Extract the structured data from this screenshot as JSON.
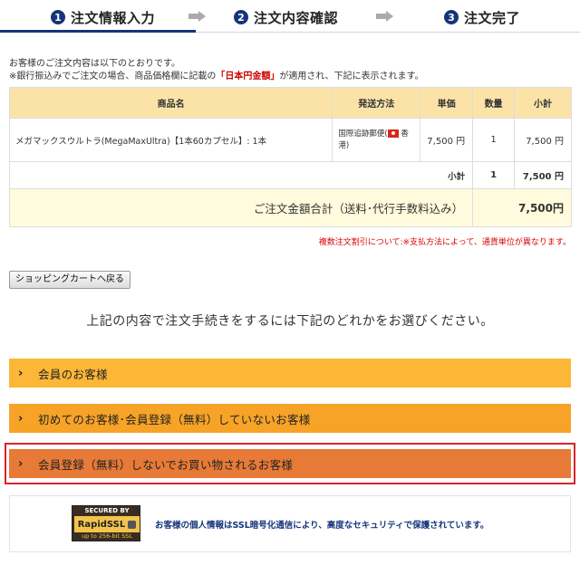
{
  "steps": {
    "step1": {
      "number": "1",
      "label": "注文情報入力"
    },
    "step2": {
      "number": "2",
      "label": "注文内容確認"
    },
    "step3": {
      "number": "3",
      "label": "注文完了"
    }
  },
  "intro": {
    "line1": "お客様のご注文内容は以下のとおりです。",
    "line2_prefix": "※銀行振込みでご注文の場合、商品価格欄に記載の",
    "line2_highlight": "「日本円金額」",
    "line2_suffix": "が適用され、下記に表示されます。"
  },
  "table": {
    "headers": {
      "name": "商品名",
      "shipping": "発送方法",
      "price": "単価",
      "qty": "数量",
      "subtotal": "小計"
    },
    "items": [
      {
        "name": "メガマックスウルトラ(MegaMaxUltra)【1本60カプセル】: 1本",
        "shipping_prefix": "国際追跡郵便(",
        "shipping_suffix": " 香港)",
        "flag_icon": "hong-kong-flag-icon",
        "price": "7,500 円",
        "qty": "1",
        "subtotal": "7,500 円"
      }
    ],
    "subtotal_row": {
      "label": "小計",
      "qty": "1",
      "value": "7,500 円"
    },
    "total_row": {
      "label": "ご注文金額合計（送料･代行手数料込み）",
      "value": "7,500円"
    }
  },
  "note": "複数注文割引について:※支払方法によって、通貨単位が異なります。",
  "back_button": "ショッピングカートへ戻る",
  "choose_text": "上記の内容で注文手続きをするには下記のどれかをお選びください。",
  "options": [
    {
      "label": "会員のお客様",
      "color": "#fcb737"
    },
    {
      "label": "初めてのお客様･会員登録（無料）していないお客様",
      "color": "#f7a327"
    },
    {
      "label": "会員登録（無料）しないでお買い物されるお客様",
      "color": "#e87a37"
    }
  ],
  "ssl": {
    "badge_top": "SECURED BY",
    "badge_brand": "RapidSSL",
    "badge_bottom": "up to 256-bit SSL",
    "text": "お客様の個人情報はSSL暗号化通信により、高度なセキュリティで保護されています。"
  },
  "colors": {
    "brand_navy": "#15357a",
    "highlight_red": "#d8242b"
  }
}
